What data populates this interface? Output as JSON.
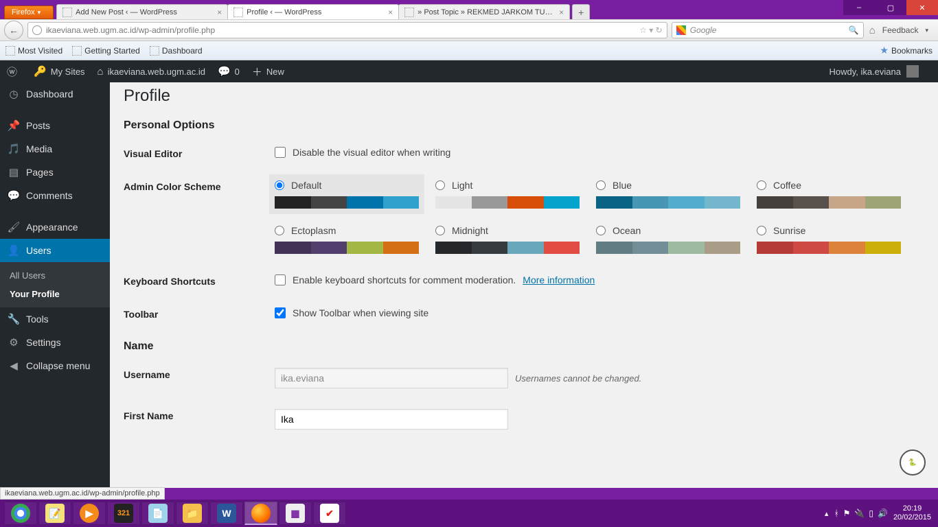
{
  "window": {
    "firefox_label": "Firefox",
    "tabs": [
      {
        "title": "Add New Post ‹ — WordPress"
      },
      {
        "title": "Profile ‹ — WordPress"
      },
      {
        "title": "» Post Topic » REKMED JARKOM TUG..."
      }
    ],
    "min": "–",
    "max": "▢",
    "close": "✕"
  },
  "nav": {
    "url": "ikaeviana.web.ugm.ac.id/wp-admin/profile.php",
    "search_placeholder": "Google",
    "feedback": "Feedback"
  },
  "bookmarks": {
    "items": [
      "Most Visited",
      "Getting Started",
      "Dashboard"
    ],
    "right": "Bookmarks"
  },
  "adminbar": {
    "my_sites": "My Sites",
    "site": "ikaeviana.web.ugm.ac.id",
    "comments": "0",
    "new": "New",
    "howdy": "Howdy, ika.eviana"
  },
  "sidebar": {
    "dashboard": "Dashboard",
    "posts": "Posts",
    "media": "Media",
    "pages": "Pages",
    "comments": "Comments",
    "appearance": "Appearance",
    "users": "Users",
    "all_users": "All Users",
    "your_profile": "Your Profile",
    "tools": "Tools",
    "settings": "Settings",
    "collapse": "Collapse menu"
  },
  "profile": {
    "title": "Profile",
    "personal_options": "Personal Options",
    "visual_editor_label": "Visual Editor",
    "visual_editor_chk": "Disable the visual editor when writing",
    "color_scheme_label": "Admin Color Scheme",
    "colors": {
      "default": "Default",
      "light": "Light",
      "blue": "Blue",
      "coffee": "Coffee",
      "ectoplasm": "Ectoplasm",
      "midnight": "Midnight",
      "ocean": "Ocean",
      "sunrise": "Sunrise"
    },
    "swatches": {
      "default": [
        "#222",
        "#444",
        "#0073aa",
        "#2ea2cc"
      ],
      "light": [
        "#e5e5e5",
        "#999",
        "#d64e07",
        "#04a4cc"
      ],
      "blue": [
        "#096484",
        "#4796b3",
        "#52accc",
        "#74B6CE"
      ],
      "coffee": [
        "#46403c",
        "#59524c",
        "#c7a589",
        "#9ea476"
      ],
      "ectoplasm": [
        "#413256",
        "#523f6d",
        "#a3b745",
        "#d46f15"
      ],
      "midnight": [
        "#25282b",
        "#363b3f",
        "#69a8bb",
        "#e14d43"
      ],
      "ocean": [
        "#627c83",
        "#738e96",
        "#9ebaa0",
        "#aa9d88"
      ],
      "sunrise": [
        "#b43c38",
        "#cf4944",
        "#dd823b",
        "#ccaf0b"
      ]
    },
    "kb_label": "Keyboard Shortcuts",
    "kb_chk": "Enable keyboard shortcuts for comment moderation.",
    "kb_more": "More information",
    "toolbar_label": "Toolbar",
    "toolbar_chk": "Show Toolbar when viewing site",
    "name_section": "Name",
    "username_label": "Username",
    "username_value": "ika.eviana",
    "username_hint": "Usernames cannot be changed.",
    "firstname_label": "First Name",
    "firstname_value": "Ika"
  },
  "status_url": "ikaeviana.web.ugm.ac.id/wp-admin/profile.php",
  "tray": {
    "time": "20:19",
    "date": "20/02/2015"
  }
}
